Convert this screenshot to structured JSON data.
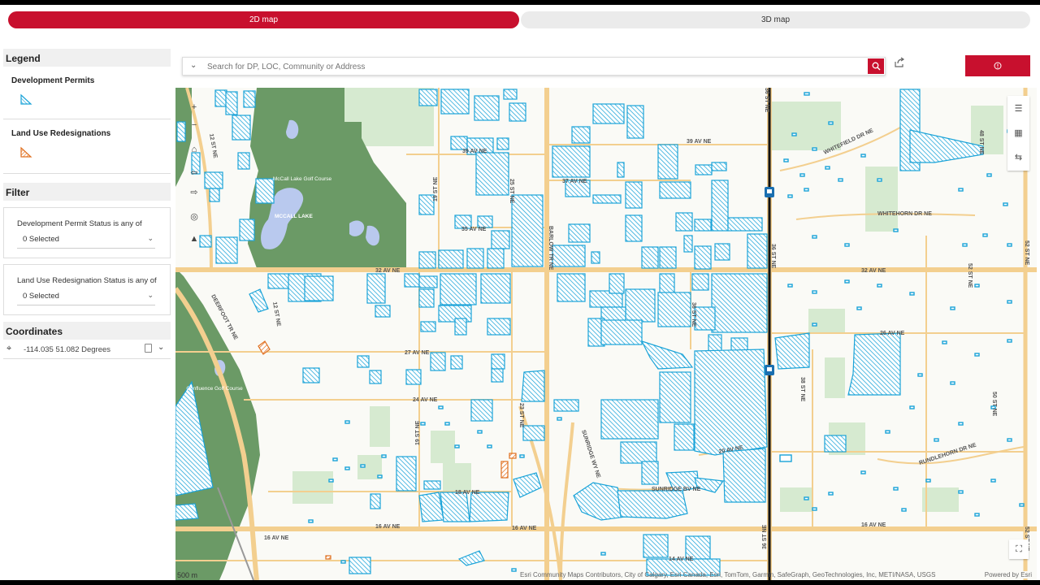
{
  "tabs": {
    "map2d": "2D map",
    "map3d": "3D map"
  },
  "legend": {
    "title": "Legend",
    "development_permits": "Development Permits",
    "land_use_redesignations": "Land Use Redesignations"
  },
  "filter": {
    "title": "Filter",
    "dp_label": "Development Permit Status is any of",
    "dp_value": "0 Selected",
    "lur_label": "Land Use Redesignation Status is any of",
    "lur_value": "0 Selected"
  },
  "coordinates": {
    "title": "Coordinates",
    "value": "-114.035 51.082 Degrees"
  },
  "search": {
    "placeholder": "Search for DP, LOC, Community or Address"
  },
  "map": {
    "streets": {
      "ave39": "39 AV NE",
      "ave37": "37 AV NE",
      "ave35": "35 AV NE",
      "ave32a": "32 AV NE",
      "ave32b": "32 AV NE",
      "ave27": "27 AV NE",
      "ave26": "26 AV NE",
      "ave24": "24 AV NE",
      "ave20": "20 AV NE",
      "ave18": "18 AV NE",
      "ave16a": "16 AV NE",
      "ave16b": "16 AV NE",
      "ave16c": "16 AV NE",
      "ave16d": "16 AV NE",
      "ave14": "14 AV NE",
      "st12a": "12 ST NE",
      "st12b": "12 ST NE",
      "st19a": "19 ST NE",
      "st19b": "19 ST NE",
      "st23": "23 ST NE",
      "st25": "25 ST NE",
      "barlow": "BARLOW TR NE",
      "st36a": "36 ST NE",
      "st36b": "36 ST NE",
      "st36c": "36 ST NE",
      "st38": "38 ST NE",
      "st48": "48 ST NE",
      "st50": "50 ST NE",
      "st52a": "52 ST NE",
      "st52b": "52 ST NE",
      "st52c": "52 ST NE",
      "whitefield": "WHITEFIELD DR NE",
      "whitehorn": "WHITEHORN DR NE",
      "rundlehorn": "RUNDLEHORN DR NE",
      "sunridge_blvd": "SUNRIDGE BV NE",
      "sunridge_way": "SUNRIDGE WY NE",
      "deerfoot": "DEERFOOT TR NE"
    },
    "places": {
      "mccall_lake": "MCCALL LAKE",
      "mccall_golf": "McCall Lake Golf Course",
      "golf_bottom": "Confluence Golf Course"
    },
    "scale": "500 m",
    "attribution": "Esri Community Maps Contributors, City of Calgary, Esri Canada, Esri, TomTom, Garmin, SafeGraph, GeoTechnologies, Inc, METI/NASA, USGS",
    "powered": "Powered by Esri"
  },
  "icons": {
    "search": "search-icon",
    "share": "share-icon",
    "alert": "alert-icon",
    "zoom_in": "plus-icon",
    "zoom_out": "minus-icon",
    "home": "home-icon",
    "back": "arrow-left-icon",
    "forward": "arrow-right-icon",
    "locate": "locate-icon",
    "compass": "compass-icon",
    "layers": "layers-icon",
    "basemap": "grid-icon",
    "swipe": "swipe-icon",
    "fullscreen": "fullscreen-icon",
    "copy": "copy-icon",
    "crosshair": "crosshair-icon"
  },
  "colors": {
    "accent": "#c8102e",
    "permit": "#1aa3d8",
    "redesignation": "#e07020",
    "park": "#6b9a66",
    "greenspace": "#d6ead0",
    "water": "#b9c9ee",
    "road": "#f3cf8f"
  }
}
